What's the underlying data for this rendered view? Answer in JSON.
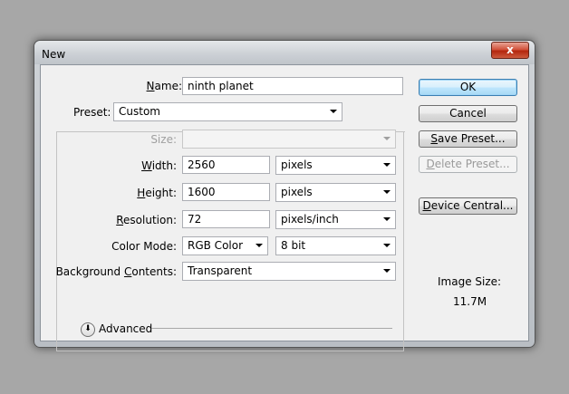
{
  "window": {
    "title": "New",
    "close_glyph": "x"
  },
  "form": {
    "name": {
      "label_pre": "",
      "label_key": "N",
      "label_post": "ame:",
      "value": "ninth planet"
    },
    "preset": {
      "label": "Preset:",
      "value": "Custom"
    },
    "size": {
      "label": "Size:",
      "value": ""
    },
    "width": {
      "label_key": "W",
      "label_post": "idth:",
      "value": "2560",
      "unit": "pixels"
    },
    "height": {
      "label_key": "H",
      "label_post": "eight:",
      "value": "1600",
      "unit": "pixels"
    },
    "resolution": {
      "label_key": "R",
      "label_post": "esolution:",
      "value": "72",
      "unit": "pixels/inch"
    },
    "color_mode": {
      "label": "Color Mode:",
      "mode": "RGB Color",
      "depth": "8 bit"
    },
    "background": {
      "label_pre": "Background ",
      "label_key": "C",
      "label_post": "ontents:",
      "value": "Transparent"
    },
    "advanced": {
      "label": "Advanced",
      "icon": "double-chevron-down-icon"
    }
  },
  "buttons": {
    "ok": "OK",
    "cancel": "Cancel",
    "save_preset": {
      "key": "S",
      "rest": "ave Preset..."
    },
    "delete_preset": {
      "key": "D",
      "rest": "elete Preset..."
    },
    "device_central": {
      "key": "D",
      "rest": "evice Central..."
    }
  },
  "image_size": {
    "label": "Image Size:",
    "value": "11.7M"
  }
}
